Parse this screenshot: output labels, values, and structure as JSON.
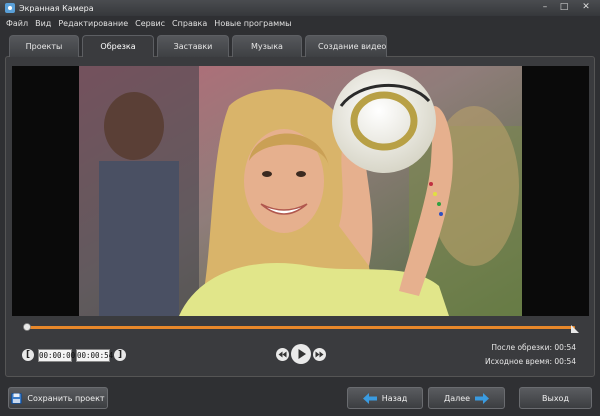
{
  "window": {
    "title": "Экранная Камера",
    "controls": [
      "–",
      "□",
      "✕"
    ]
  },
  "menu": [
    "Файл",
    "Вид",
    "Редактирование",
    "Сервис",
    "Справка",
    "Новые программы"
  ],
  "tabs": [
    {
      "label": "Проекты",
      "active": false
    },
    {
      "label": "Обрезка",
      "active": true
    },
    {
      "label": "Заставки",
      "active": false
    },
    {
      "label": "Музыка",
      "active": false
    },
    {
      "label": "Создание видео",
      "active": false
    }
  ],
  "trim": {
    "start_time": "00:00:00",
    "end_time": "00:00:54"
  },
  "info": {
    "after_trim_label": "После обрезки:",
    "after_trim_value": "00:54",
    "original_label": "Исходное время:",
    "original_value": "00:54"
  },
  "buttons": {
    "save_project": "Сохранить проект",
    "back": "Назад",
    "next": "Далее",
    "exit": "Выход"
  },
  "colors": {
    "timeline_accent": "#e8882a",
    "arrow_blue": "#3a9be0"
  }
}
